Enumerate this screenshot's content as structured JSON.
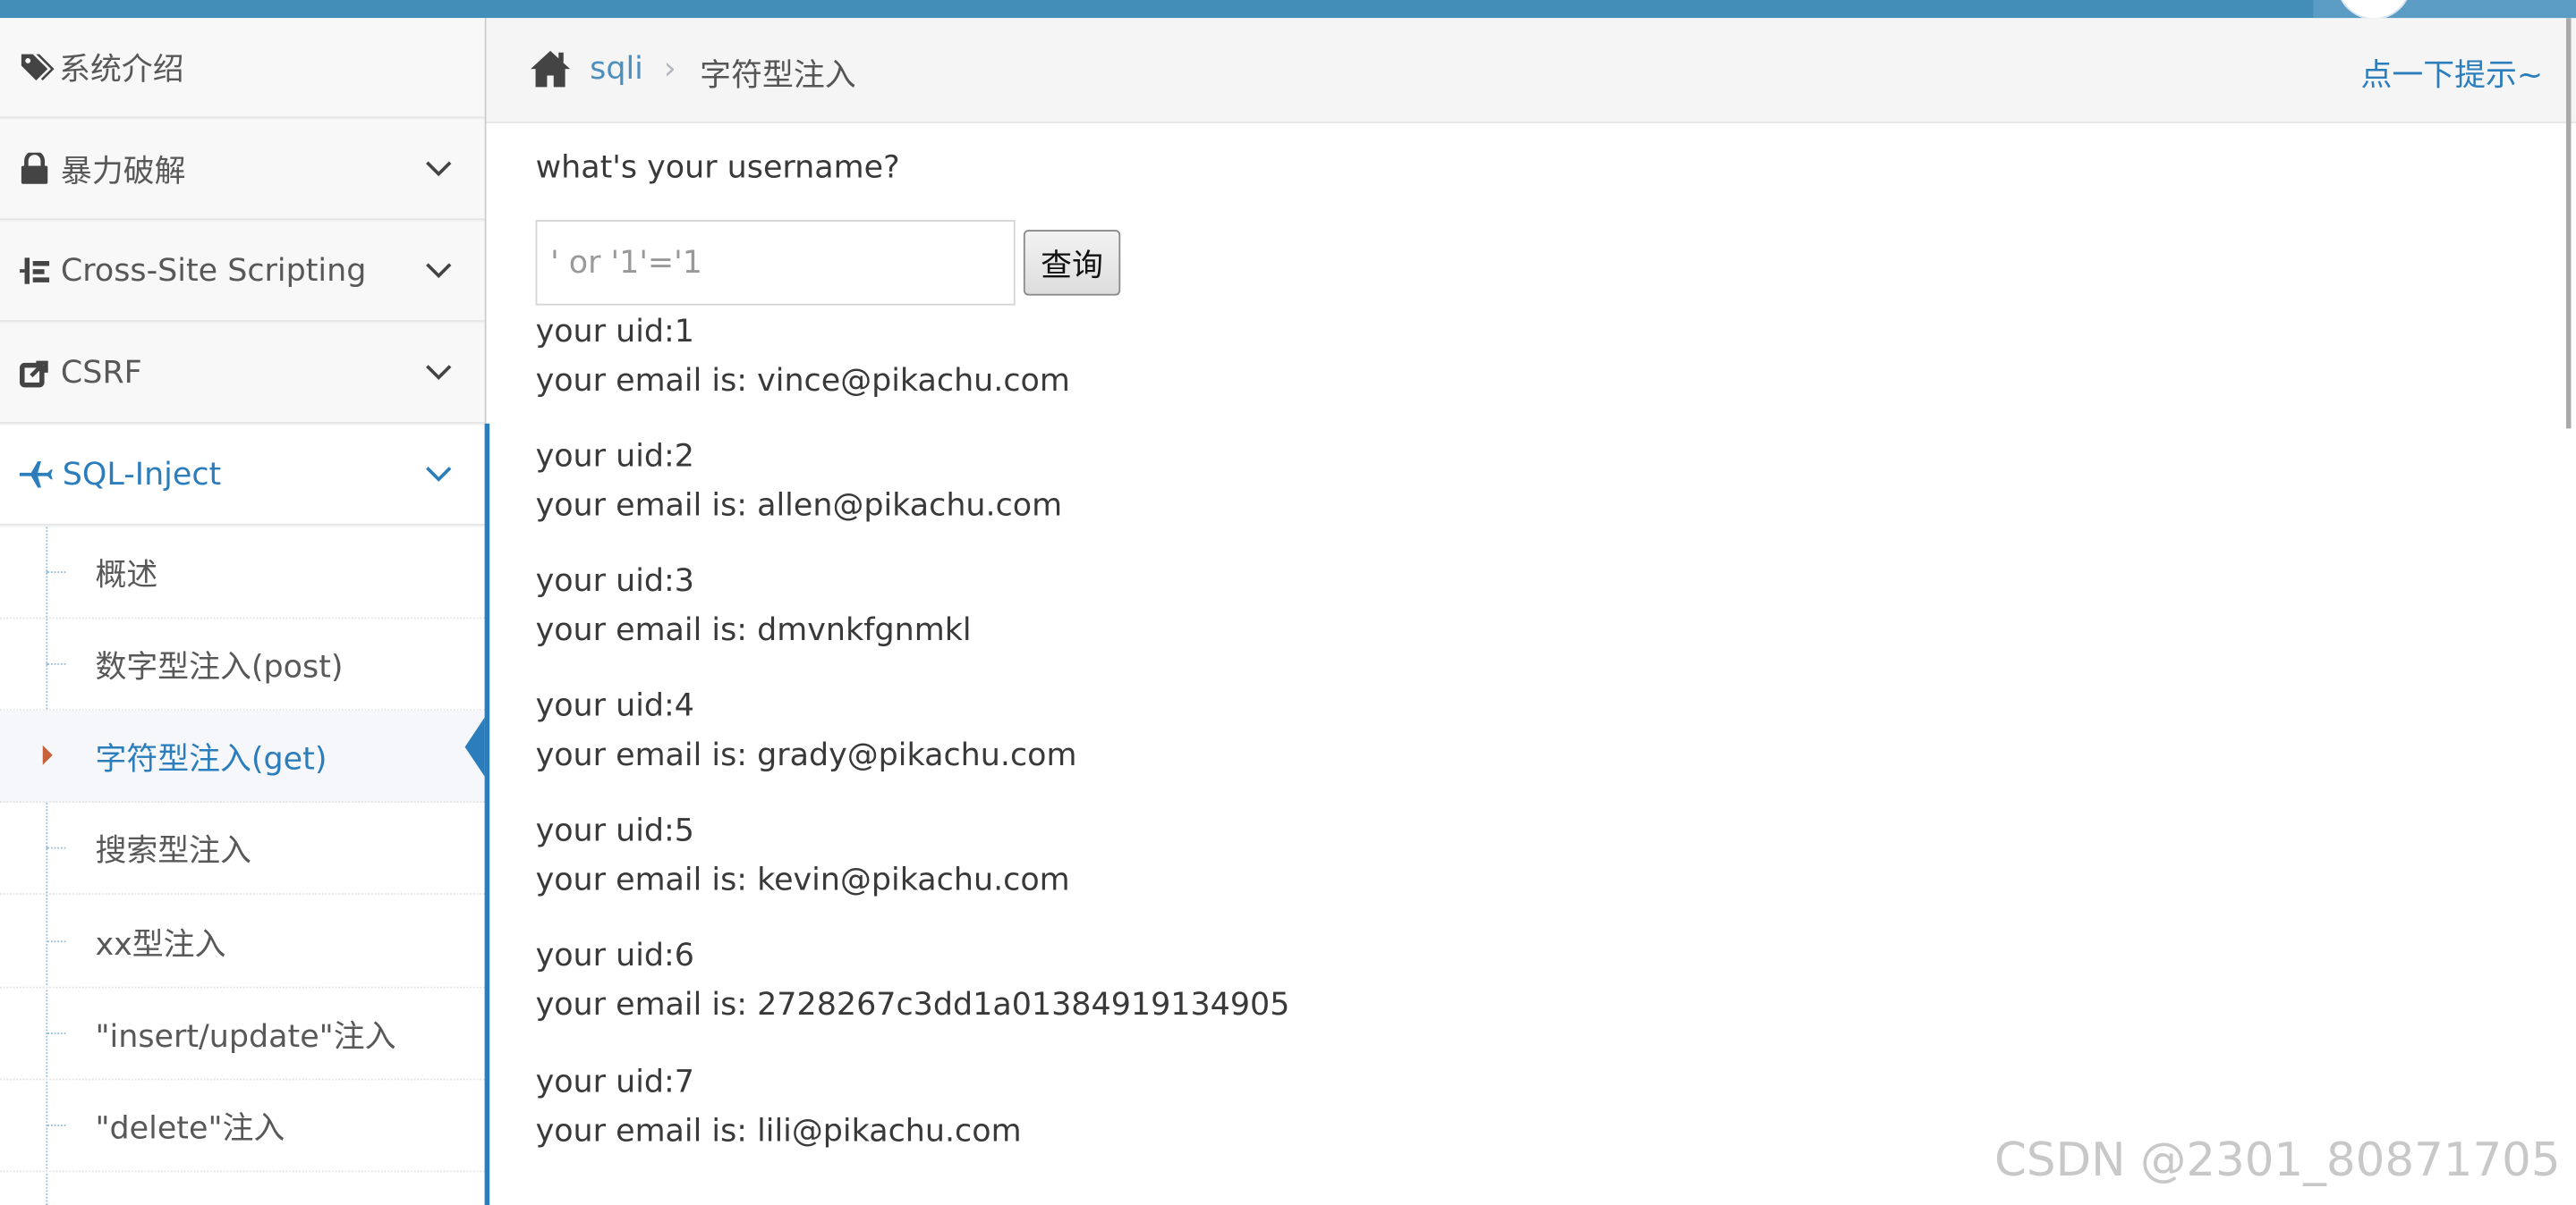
{
  "sidebar": {
    "intro": "系统介绍",
    "items": [
      {
        "label": "暴力破解",
        "icon": "lock-icon"
      },
      {
        "label": "Cross-Site Scripting",
        "icon": "list-tree-icon"
      },
      {
        "label": "CSRF",
        "icon": "share-square-icon"
      },
      {
        "label": "SQL-Inject",
        "icon": "plane-icon",
        "active": true
      }
    ],
    "sub_items": [
      {
        "label": "概述"
      },
      {
        "label": "数字型注入(post)"
      },
      {
        "label": "字符型注入(get)",
        "active": true
      },
      {
        "label": "搜索型注入"
      },
      {
        "label": "xx型注入"
      },
      {
        "label": "\"insert/update\"注入"
      },
      {
        "label": "\"delete\"注入"
      }
    ]
  },
  "breadcrumbs": {
    "home_icon": "home-icon",
    "link": "sqli",
    "separator": "›",
    "current": "字符型注入",
    "hint": "点一下提示~"
  },
  "main": {
    "question": "what's your username?",
    "input_value": "' or '1'='1",
    "button_label": "查询",
    "results": [
      {
        "uid": "your uid:1",
        "email": "your email is: vince@pikachu.com"
      },
      {
        "uid": "your uid:2",
        "email": "your email is: allen@pikachu.com"
      },
      {
        "uid": "your uid:3",
        "email": "your email is: dmvnkfgnmkl"
      },
      {
        "uid": "your uid:4",
        "email": "your email is: grady@pikachu.com"
      },
      {
        "uid": "your uid:5",
        "email": "your email is: kevin@pikachu.com"
      },
      {
        "uid": "your uid:6",
        "email": "your email is: 2728267c3dd1a01384919134905"
      },
      {
        "uid": "your uid:7",
        "email": "your email is: lili@pikachu.com"
      }
    ]
  },
  "watermark": "CSDN @2301_80871705",
  "colors": {
    "accent": "#2b7dbc",
    "topbar": "#438eb9",
    "caret": "#c86139"
  }
}
